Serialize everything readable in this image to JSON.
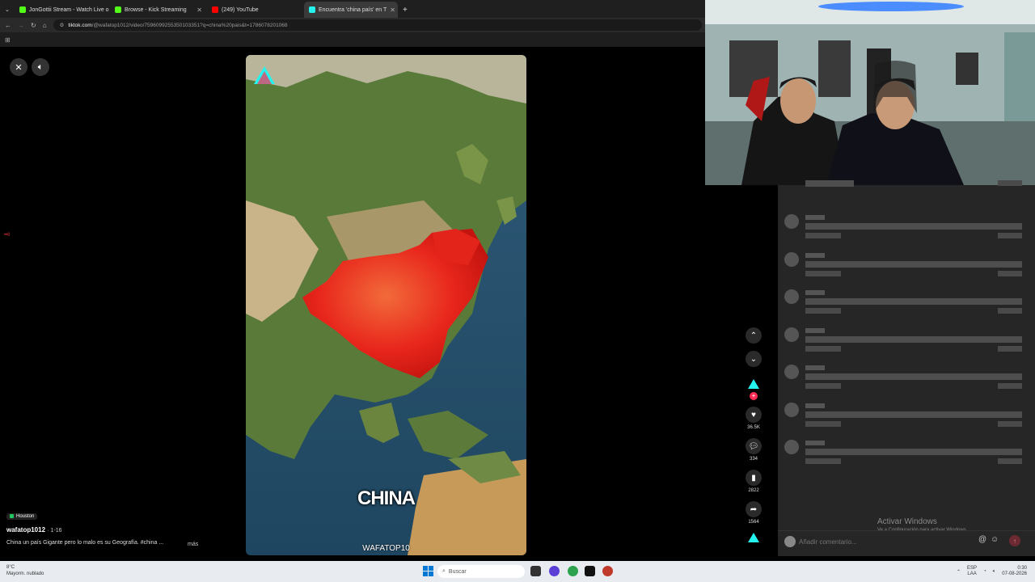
{
  "browser": {
    "tabs": [
      {
        "title": "JonGottii Stream - Watch Live o",
        "fav": "#53fc18",
        "active": false
      },
      {
        "title": "Browse - Kick Streaming",
        "fav": "#53fc18",
        "active": false
      },
      {
        "title": "(249) YouTube",
        "fav": "#ff0000",
        "active": false
      },
      {
        "title": "Encuentra 'china país' en T",
        "fav": "#25f4ee",
        "active": true
      }
    ],
    "new_tab_label": "+",
    "url_host": "tiktok.com",
    "url_path": "/@wafatop1012/video/7596099255350103351?q=china%20pais&t=1786078201068"
  },
  "player": {
    "close_icon": "close-icon",
    "mute_icon": "volume-icon",
    "video_title": "CHINA",
    "watermark": "WAFATOP10",
    "corner_badge": "••ll"
  },
  "actions": {
    "likes": "36.5K",
    "comments": "334",
    "saves": "2822",
    "shares": "1564"
  },
  "caption": {
    "location": "Houston",
    "author": "wafatop1012",
    "date": "1-16",
    "description": "China un país Gigante pero lo malo es su Geografía. #china ...",
    "more": "más"
  },
  "comment_input": {
    "placeholder": "Añadir comentario..."
  },
  "windows_notice": {
    "title": "Activar Windows",
    "subtitle": "Ve a Configuración para activar Windows."
  },
  "taskbar": {
    "weather_temp": "8°C",
    "weather_desc": "Mayorm. nublado",
    "search_label": "Buscar",
    "lang_top": "ESP",
    "lang_bottom": "LAA",
    "time": "0:30",
    "date": "07-08-2026"
  },
  "colors": {
    "tiktok_red": "#fe2c55",
    "tiktok_cyan": "#25f4ee",
    "china_red": "#e8261c"
  }
}
